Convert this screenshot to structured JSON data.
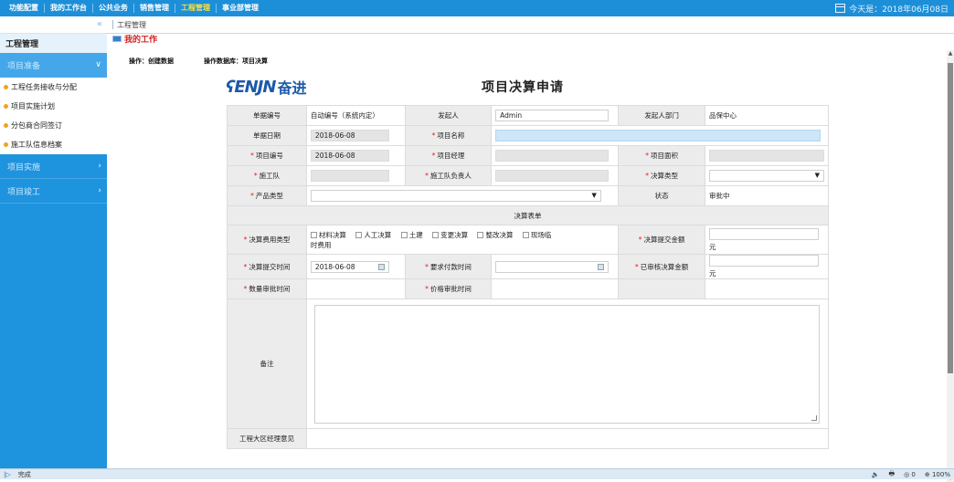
{
  "topnav": {
    "items": [
      "功能配置",
      "我的工作台",
      "公共业务",
      "销售管理",
      "工程管理",
      "事业部管理"
    ],
    "active_index": 4,
    "date_text": "今天是：2018年06月08日"
  },
  "sidebar": {
    "collapse_icon": "«",
    "title": "工程管理",
    "sections": [
      {
        "label": "项目准备",
        "chevron": "∨",
        "items": [
          "工程任务接收与分配",
          "项目实施计划",
          "分包商合同签订",
          "施工队信息档案"
        ]
      },
      {
        "label": "项目实施",
        "chevron": "›"
      },
      {
        "label": "项目竣工",
        "chevron": "›"
      }
    ]
  },
  "main": {
    "tab_title": "工程管理",
    "my_work": "我的工作",
    "op_label": "操作：创建数据",
    "db_label": "操作数据库：项目决算",
    "logo_mark": "ENJN",
    "logo_cn": "奋进",
    "page_title": "项目决算申请"
  },
  "form": {
    "r1": {
      "l1": "单据编号",
      "v1": "自动编号（系统内定）",
      "l2": "发起人",
      "v2": "Admin",
      "l3": "发起人部门",
      "v3": "品保中心"
    },
    "r2": {
      "l1": "单据日期",
      "v1": "2018-06-08",
      "l2": "项目名称"
    },
    "r3": {
      "l1": "项目编号",
      "v1": "2018-06-08",
      "l2": "项目经理",
      "l3": "项目面积"
    },
    "r4": {
      "l1": "施工队",
      "l2": "施工队负责人",
      "l3": "决算类型"
    },
    "r5": {
      "l1": "产品类型",
      "l3": "状态",
      "v3": "审批中"
    },
    "section": "决算表单",
    "r6": {
      "l1": "决算费用类型",
      "checks": [
        "材料决算",
        "人工决算",
        "土建",
        "变更决算",
        "整改决算",
        "现场临"
      ],
      "wrap": "时费用",
      "l2": "决算提交金额",
      "unit": "元"
    },
    "r7": {
      "l1": "决算提交时间",
      "v1": "2018-06-08",
      "l2": "要求付款时间",
      "l3": "已审核决算金额",
      "unit": "元"
    },
    "r8": {
      "l1": "数量审批时间",
      "l2": "价格审批时间"
    },
    "r9": {
      "l1": "备注"
    },
    "r10": {
      "l1": "工程大区经理意见"
    }
  },
  "status": {
    "icon": "|▷",
    "text": "完成",
    "right": [
      "🔈",
      "🖶",
      "◎ 0",
      "⊕ 100%"
    ]
  }
}
